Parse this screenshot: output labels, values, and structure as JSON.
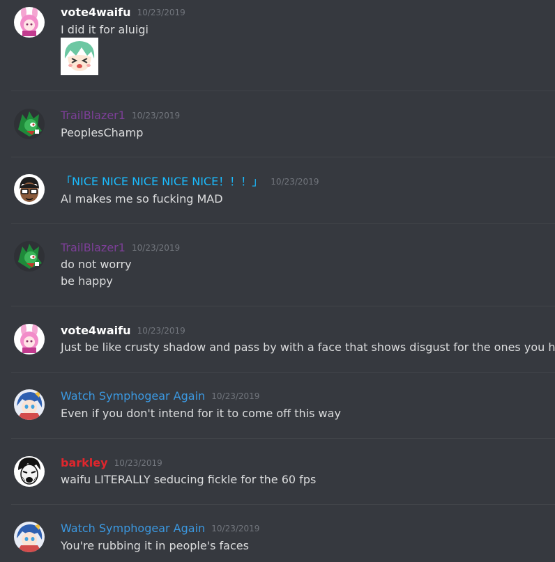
{
  "colors": {
    "background": "#36393f",
    "text": "#dcddde",
    "timestamp": "#72767d",
    "divider": "#42454a",
    "vote4waifu": "#ffffff",
    "trailblazer": "#7d3f98",
    "nice": "#1abcff",
    "symphogear": "#3b98e0",
    "barkley": "#e0262d"
  },
  "messages": [
    {
      "username": "vote4waifu",
      "timestamp": "10/23/2019",
      "lines": [
        "I did it for aluigi"
      ],
      "avatar": "pink-anime-girl-avatar",
      "attachment": "green-anime-emoji"
    },
    {
      "username": "TrailBlazer1",
      "timestamp": "10/23/2019",
      "lines": [
        "PeoplesChamp"
      ],
      "avatar": "green-hedgehog-avatar"
    },
    {
      "username": "「NICE NICE NICE NICE NICE！！！」",
      "timestamp": "10/23/2019",
      "lines": [
        "AI makes me so fucking MAD"
      ],
      "avatar": "glasses-guy-avatar"
    },
    {
      "username": "TrailBlazer1",
      "timestamp": "10/23/2019",
      "lines": [
        "do not worry",
        "be happy"
      ],
      "avatar": "green-hedgehog-avatar"
    },
    {
      "username": "vote4waifu",
      "timestamp": "10/23/2019",
      "lines": [
        "Just be like crusty shadow and pass by with a face that shows disgust for the ones you hate"
      ],
      "avatar": "pink-anime-girl-avatar"
    },
    {
      "username": "Watch Symphogear Again",
      "timestamp": "10/23/2019",
      "lines": [
        "Even if you don't intend for it to come off this way"
      ],
      "avatar": "blue-anime-avatar"
    },
    {
      "username": "barkley",
      "timestamp": "10/23/2019",
      "lines": [
        "waifu LITERALLY seducing fickle for the 60 fps"
      ],
      "avatar": "manga-face-avatar"
    },
    {
      "username": "Watch Symphogear Again",
      "timestamp": "10/23/2019",
      "lines": [
        "You're rubbing it in people's faces"
      ],
      "avatar": "blue-anime-avatar"
    }
  ]
}
